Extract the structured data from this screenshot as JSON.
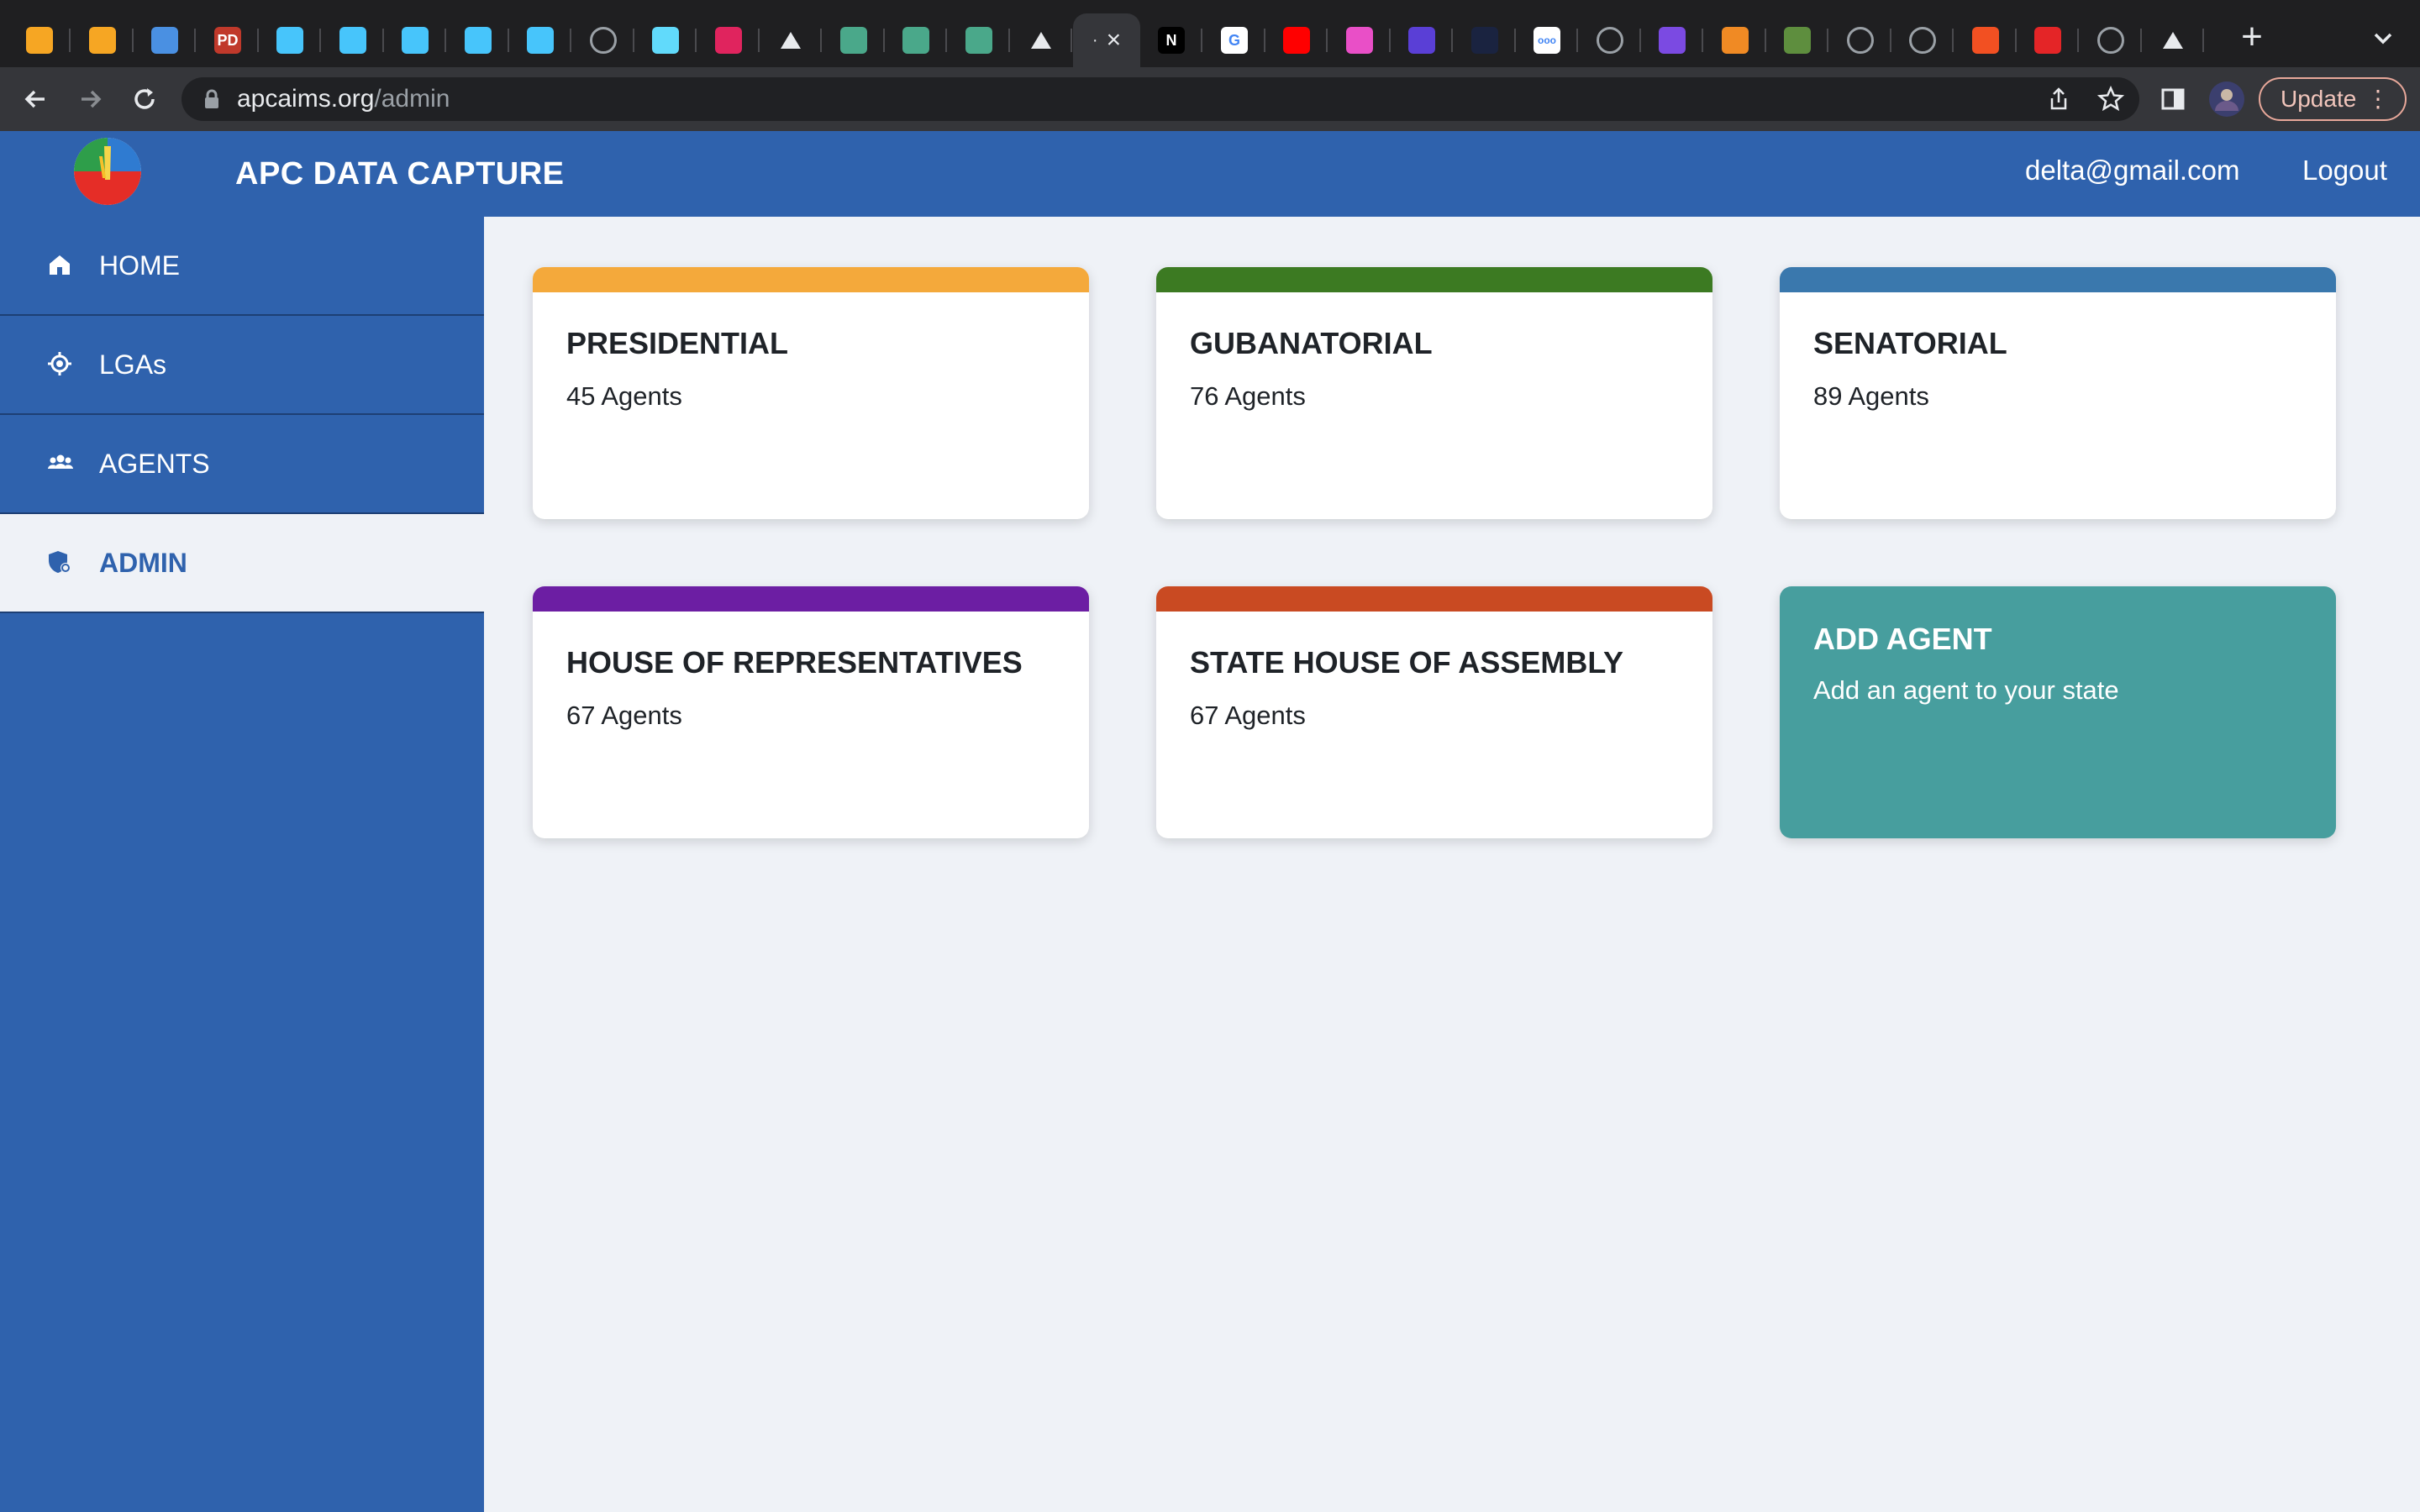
{
  "browser": {
    "url_domain": "apcaims.org",
    "url_path": "/admin",
    "update_label": "Update",
    "tabs": [
      {
        "icon": "firebase-icon",
        "color": "#f6a623"
      },
      {
        "icon": "firebase-icon",
        "color": "#f6a623"
      },
      {
        "icon": "cloud-functions-icon",
        "color": "#4a90e2"
      },
      {
        "icon": "pd-icon",
        "color": "#c0392b",
        "glyph": "PD"
      },
      {
        "icon": "flutter-icon",
        "color": "#47c5fb"
      },
      {
        "icon": "flutter-icon",
        "color": "#47c5fb"
      },
      {
        "icon": "flutter-icon",
        "color": "#47c5fb"
      },
      {
        "icon": "flutter-icon",
        "color": "#47c5fb"
      },
      {
        "icon": "flutter-icon",
        "color": "#47c5fb"
      },
      {
        "icon": "globe-icon",
        "color": "#9aa0a6"
      },
      {
        "icon": "react-icon",
        "color": "#61dafb"
      },
      {
        "icon": "react-icon",
        "color": "#e0245e"
      },
      {
        "icon": "triangle-icon",
        "color": "#111111"
      },
      {
        "icon": "p-icon",
        "color": "#4aa88a"
      },
      {
        "icon": "p-icon",
        "color": "#4aa88a"
      },
      {
        "icon": "p-icon",
        "color": "#4aa88a"
      },
      {
        "icon": "triangle-icon",
        "color": "#111111"
      },
      {
        "icon": "active-tab",
        "color": "#35363a"
      },
      {
        "icon": "nextjs-icon",
        "color": "#000000",
        "glyph": "N"
      },
      {
        "icon": "google-icon",
        "color": "#ffffff",
        "glyph": "G"
      },
      {
        "icon": "youtube-icon",
        "color": "#ff0000"
      },
      {
        "icon": "elementor-icon",
        "color": "#e94fc7"
      },
      {
        "icon": "wave-icon",
        "color": "#5a3fd6"
      },
      {
        "icon": "dark-icon",
        "color": "#1a2340"
      },
      {
        "icon": "medium-icon",
        "color": "#ffffff",
        "glyph": "ooo"
      },
      {
        "icon": "globe-icon",
        "color": "#9aa0a6"
      },
      {
        "icon": "p-icon",
        "color": "#7b4ae2"
      },
      {
        "icon": "tech-icon",
        "color": "#f08a24"
      },
      {
        "icon": "shopify-icon",
        "color": "#5e8e3e"
      },
      {
        "icon": "tree-icon",
        "color": "#9aa0a6"
      },
      {
        "icon": "globe-icon",
        "color": "#9aa0a6"
      },
      {
        "icon": "microsoft-icon",
        "color": "#f25022"
      },
      {
        "icon": "zoho-icon",
        "color": "#e42527"
      },
      {
        "icon": "cube-icon",
        "color": "#9aa0a6"
      },
      {
        "icon": "triangle-icon",
        "color": "#111111"
      }
    ]
  },
  "header": {
    "app_title": "APC DATA CAPTURE",
    "user_email": "delta@gmail.com",
    "logout_label": "Logout",
    "brand_color": "#2f62ad"
  },
  "sidebar": {
    "items": [
      {
        "label": "HOME",
        "icon": "home-icon",
        "active": false
      },
      {
        "label": "LGAs",
        "icon": "location-target-icon",
        "active": false
      },
      {
        "label": "AGENTS",
        "icon": "people-icon",
        "active": false
      },
      {
        "label": "ADMIN",
        "icon": "admin-shield-icon",
        "active": true
      }
    ]
  },
  "cards": [
    {
      "title": "PRESIDENTIAL",
      "count": "45 Agents",
      "accent": "#f4a93b"
    },
    {
      "title": "GUBANATORIAL",
      "count": "76 Agents",
      "accent": "#3c7a22"
    },
    {
      "title": "SENATORIAL",
      "count": "89 Agents",
      "accent": "#3a78ad"
    },
    {
      "title": "HOUSE OF REPRESENTATIVES",
      "count": "67 Agents",
      "accent": "#6c1ea3"
    },
    {
      "title": "STATE HOUSE OF ASSEMBLY",
      "count": "67 Agents",
      "accent": "#c94a22"
    },
    {
      "title": "ADD AGENT",
      "count": "Add an agent to your state",
      "accent": "#479e9e"
    }
  ]
}
